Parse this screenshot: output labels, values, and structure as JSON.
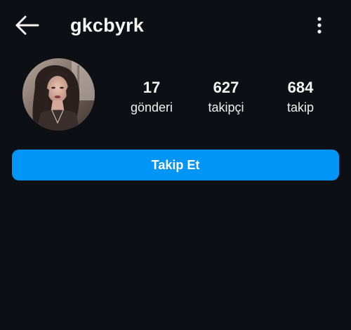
{
  "header": {
    "back_icon": "arrow-left-icon",
    "username": "gkcbyrk",
    "more_icon": "more-vertical-icon"
  },
  "profile": {
    "avatar": "profile-photo",
    "stats": [
      {
        "count": "17",
        "label": "gönderi"
      },
      {
        "count": "627",
        "label": "takipçi"
      },
      {
        "count": "684",
        "label": "takip"
      }
    ]
  },
  "actions": {
    "follow_label": "Takip Et"
  },
  "colors": {
    "background": "#0c1014",
    "accent": "#0095f6",
    "text": "#f5f5f5"
  }
}
